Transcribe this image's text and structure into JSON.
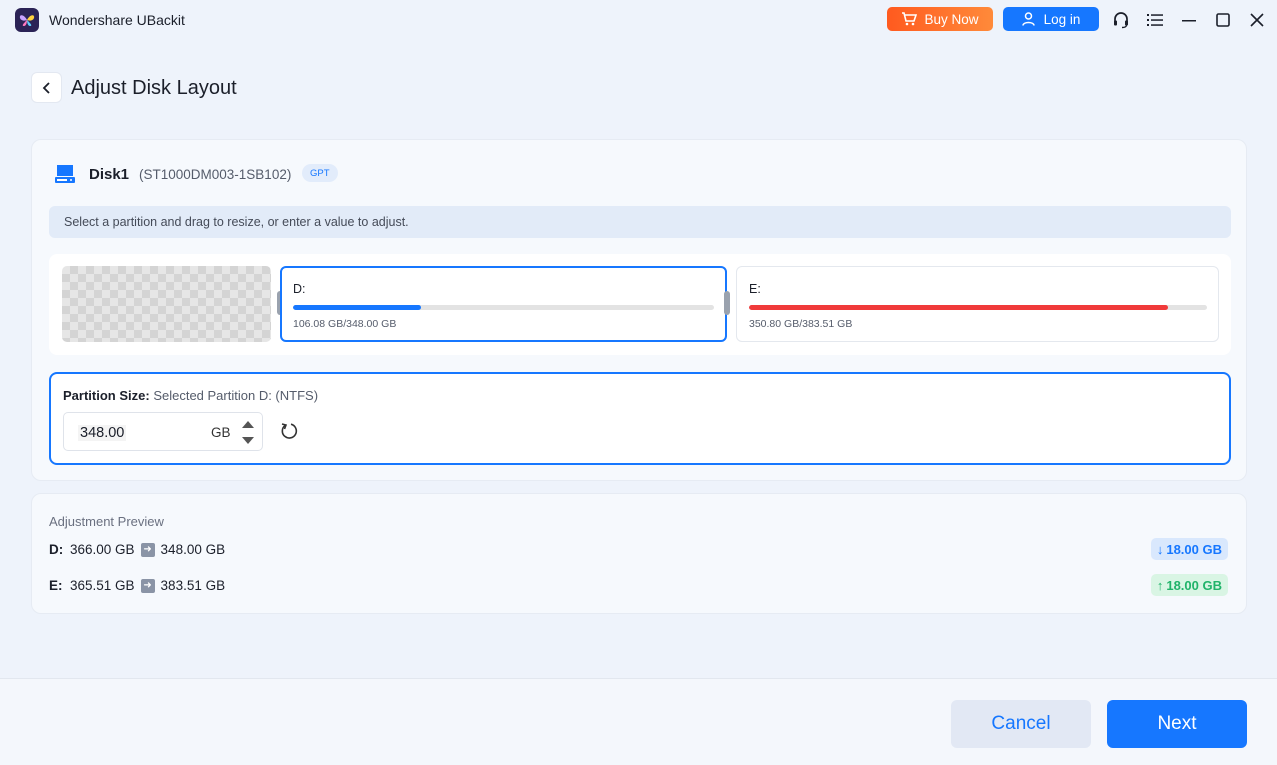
{
  "app": {
    "title": "Wondershare UBackit"
  },
  "titlebar": {
    "buy_label": "Buy Now",
    "login_label": "Log in",
    "icons": [
      "cart-icon",
      "user-icon",
      "headset-icon",
      "menu-icon",
      "minimize-icon",
      "maximize-icon",
      "close-icon"
    ]
  },
  "page": {
    "title": "Adjust Disk Layout"
  },
  "disk": {
    "name": "Disk1",
    "model": "(ST1000DM003-1SB102)",
    "badge": "GPT",
    "hint": "Select a partition and drag to resize, or enter a value to adjust.",
    "partitions": [
      {
        "label": "D:",
        "size_text": "106.08 GB/348.00 GB",
        "used_fraction": 0.305,
        "color": "#1677ff",
        "selected": true
      },
      {
        "label": "E:",
        "size_text": "350.80 GB/383.51 GB",
        "used_fraction": 0.915,
        "color": "#f03a3a",
        "selected": false
      }
    ]
  },
  "partition_size": {
    "label": "Partition Size:",
    "selected_text": "Selected Partition D: (NTFS)",
    "value": "348.00",
    "unit": "GB"
  },
  "preview": {
    "title": "Adjustment Preview",
    "rows": [
      {
        "label": "D:",
        "from": "366.00 GB",
        "to": "348.00 GB",
        "change": "18.00 GB",
        "direction": "down"
      },
      {
        "label": "E:",
        "from": "365.51 GB",
        "to": "383.51 GB",
        "change": "18.00 GB",
        "direction": "up"
      }
    ]
  },
  "footer": {
    "cancel_label": "Cancel",
    "next_label": "Next"
  },
  "colors": {
    "accent": "#1677ff",
    "buy": "#ff6a2a",
    "used_e": "#f03a3a",
    "increase": "#21b36a"
  }
}
